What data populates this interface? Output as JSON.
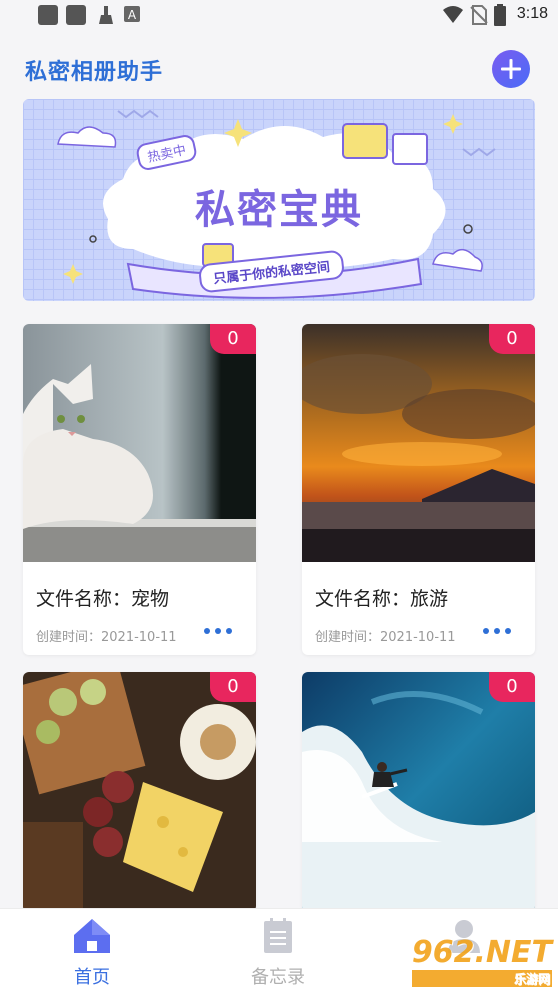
{
  "status_bar": {
    "time": "3:18"
  },
  "header": {
    "title": "私密相册助手",
    "add_icon": "plus-icon"
  },
  "banner": {
    "title": "私密宝典",
    "tag": "热卖中",
    "subtitle": "只属于你的私密空间"
  },
  "albums": [
    {
      "name": "文件名称：宠物",
      "created": "创建时间：2021-10-11",
      "count": "0"
    },
    {
      "name": "文件名称：旅游",
      "created": "创建时间：2021-10-11",
      "count": "0"
    },
    {
      "count": "0"
    },
    {
      "count": "0"
    }
  ],
  "nav": {
    "items": [
      {
        "label": "首页",
        "icon": "home-icon",
        "active": true
      },
      {
        "label": "备忘录",
        "icon": "notepad-icon",
        "active": false
      },
      {
        "label": "",
        "icon": "user-icon",
        "active": false
      }
    ]
  },
  "watermark": {
    "text": "962.NET",
    "sub": "乐游网"
  },
  "colors": {
    "accent": "#2e6fd6",
    "badge": "#e8265e",
    "nav_active": "#3a6fe0",
    "nav_inactive": "#b0b0b0"
  }
}
